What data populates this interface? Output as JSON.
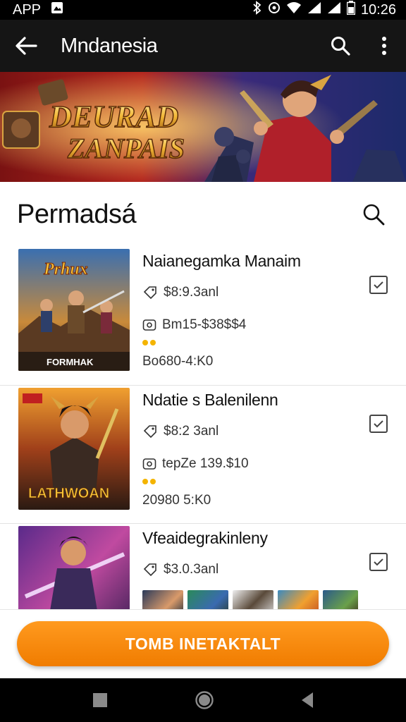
{
  "status_bar": {
    "carrier": "APP",
    "time": "10:26"
  },
  "app_bar": {
    "title": "Mndanesia"
  },
  "banner": {
    "line1": "DEURAD",
    "line2": "ZANPAIS"
  },
  "section": {
    "title": "Permadsá"
  },
  "items": [
    {
      "name": "Naianegamka Manaim",
      "version": "$8:9.3anl",
      "downloads": "Bm15-$38$$4",
      "size": "Bo680-4:K0",
      "thumb_text_top": "Prhux",
      "thumb_text_bottom": "FORMHAK"
    },
    {
      "name": "Ndatie s Balenilenn",
      "version": "$8:2 3anl",
      "downloads": "tepZe 139.$10",
      "size": "20980 5:K0",
      "thumb_text_bottom": "LATHWOAN"
    },
    {
      "name": "Vfeaidegrakinleny",
      "version": "$3.0.3anl"
    }
  ],
  "install": {
    "label": "TOMB INETAKTALT"
  },
  "colors": {
    "accent": "#f38300",
    "toolbar": "#151515",
    "star": "#f4b400"
  },
  "icons": [
    "back-arrow-icon",
    "search-icon",
    "more-vert-icon",
    "checkbox-icon",
    "square-icon",
    "circle-icon",
    "triangle-icon"
  ]
}
